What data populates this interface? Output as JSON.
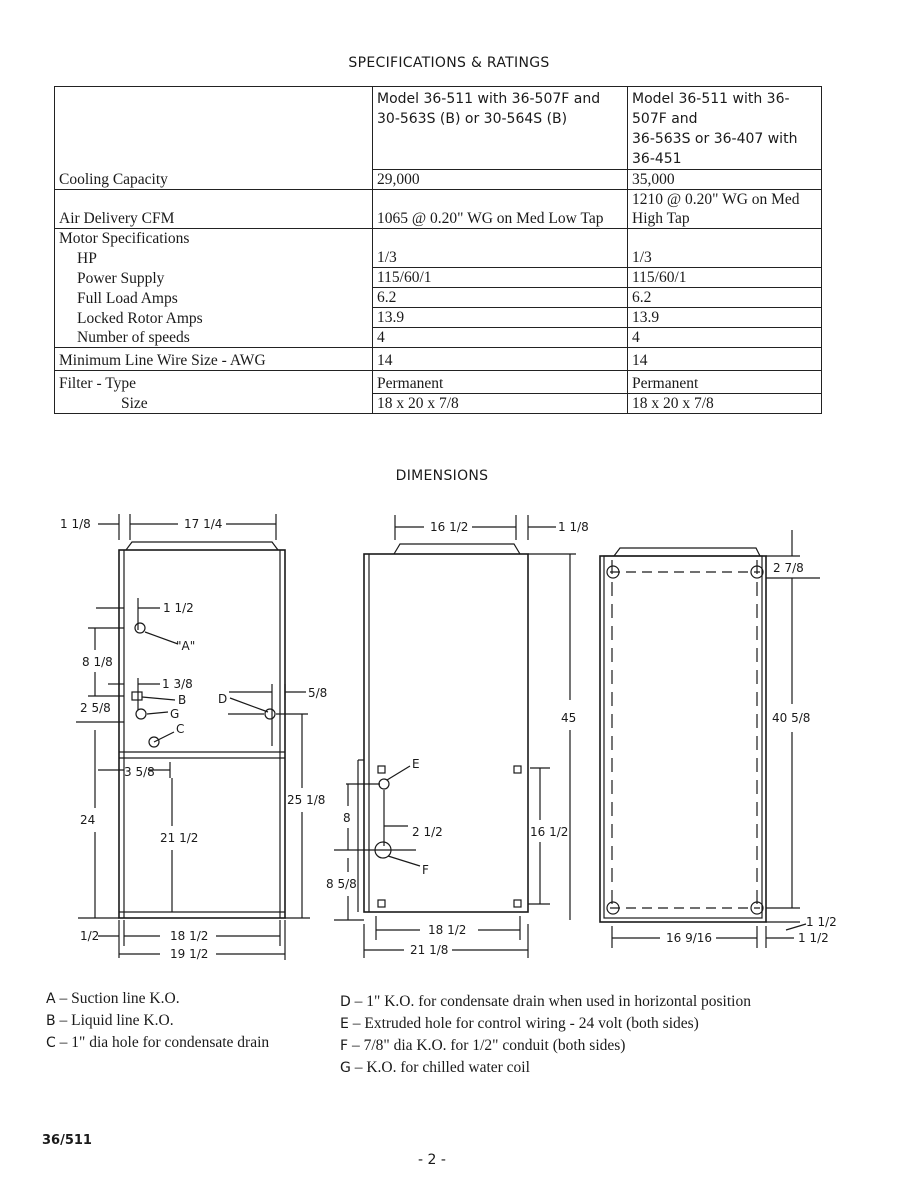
{
  "spec_title": "SPECIFICATIONS & RATINGS",
  "spec_table": {
    "header": [
      "",
      "Model 36-511 with 36-507F and 30-563S (B) or 30-564S (B)",
      "Model 36-511 with 36-507F and 36-563S or 36-407 with 36-451"
    ],
    "header_lines": [
      [
        "Model 36-511 with 36-507F and",
        "30-563S (B) or 30-564S (B)"
      ],
      [
        "Model 36-511 with 36-507F and",
        "36-563S or 36-407 with 36-451"
      ]
    ],
    "rows": [
      {
        "label": "Cooling Capacity",
        "col1": "29,000",
        "col2": "35,000"
      },
      {
        "label": "Air Delivery CFM",
        "col1": "1065 @ 0.20\" WG on Med Low Tap",
        "col2": "1210 @ 0.20\" WG on Med High Tap"
      },
      {
        "label": "Motor Specifications",
        "col1": "",
        "col2": ""
      },
      {
        "label": "HP",
        "col1": "1/3",
        "col2": "1/3"
      },
      {
        "label": "Power Supply",
        "col1": "115/60/1",
        "col2": "115/60/1"
      },
      {
        "label": "Full Load Amps",
        "col1": "6.2",
        "col2": "6.2"
      },
      {
        "label": "Locked Rotor Amps",
        "col1": "13.9",
        "col2": "13.9"
      },
      {
        "label": "Number of speeds",
        "col1": "4",
        "col2": "4"
      },
      {
        "label": "Minimum Line Wire Size - AWG",
        "col1": "14",
        "col2": "14"
      },
      {
        "label": "Filter - Type",
        "col1": "Permanent",
        "col2": "Permanent"
      },
      {
        "label": "Size",
        "col1": "18 x 20 x 7/8",
        "col2": "18 x 20 x 7/8"
      }
    ]
  },
  "dimensions_title": "DIMENSIONS",
  "front_view": {
    "dims": {
      "top_left": "1 1/8",
      "top_width": "17 1/4",
      "a_offset": "1 1/2",
      "a_label": "\"A\"",
      "height_8_1_8": "8 1/8",
      "c_offset": "1 3/8",
      "b_label": "B",
      "g_label": "G",
      "c_label": "C",
      "d_label": "D",
      "d_offset": "5/8",
      "left_2_5_8": "2 5/8",
      "left_3_5_8": "3 5/8",
      "height_24": "24",
      "height_21_1_2": "21 1/2",
      "height_25_1_8": "25 1/8",
      "bottom_1_2": "1/2",
      "bottom_18_1_2": "18 1/2",
      "bottom_19_1_2": "19 1/2"
    }
  },
  "side_view": {
    "dims": {
      "top_width": "16 1/2",
      "top_right": "1 1/8",
      "height_45": "45",
      "e_label": "E",
      "f_label": "F",
      "height_8": "8",
      "offset_2_1_2": "2 1/2",
      "height_16_1_2": "16 1/2",
      "height_8_5_8": "8 5/8",
      "bottom_18_1_2": "18 1/2",
      "bottom_21_1_8": "21 1/8"
    }
  },
  "back_view": {
    "dims": {
      "top_2_7_8": "2 7/8",
      "height_40_5_8": "40 5/8",
      "bottom_1_1_2": "1 1/2",
      "width_16_9_16": "16 9/16",
      "right_1_1_2": "1 1/2"
    }
  },
  "legend_left": [
    {
      "key": "A",
      "text": "Suction line K.O."
    },
    {
      "key": "B",
      "text": "Liquid line K.O."
    },
    {
      "key": "C",
      "text": "1\" dia hole for condensate drain"
    }
  ],
  "legend_right": [
    {
      "key": "D",
      "text": "1\" K.O. for condensate drain when used in horizontal position"
    },
    {
      "key": "E",
      "text": "Extruded hole for control wiring - 24 volt (both sides)"
    },
    {
      "key": "F",
      "text": "7/8\" dia K.O. for 1/2\" conduit (both sides)"
    },
    {
      "key": "G",
      "text": "K.O. for chilled water coil"
    }
  ],
  "legend_dash": "–",
  "footer_code": "36/511",
  "page_number": "- 2 -"
}
